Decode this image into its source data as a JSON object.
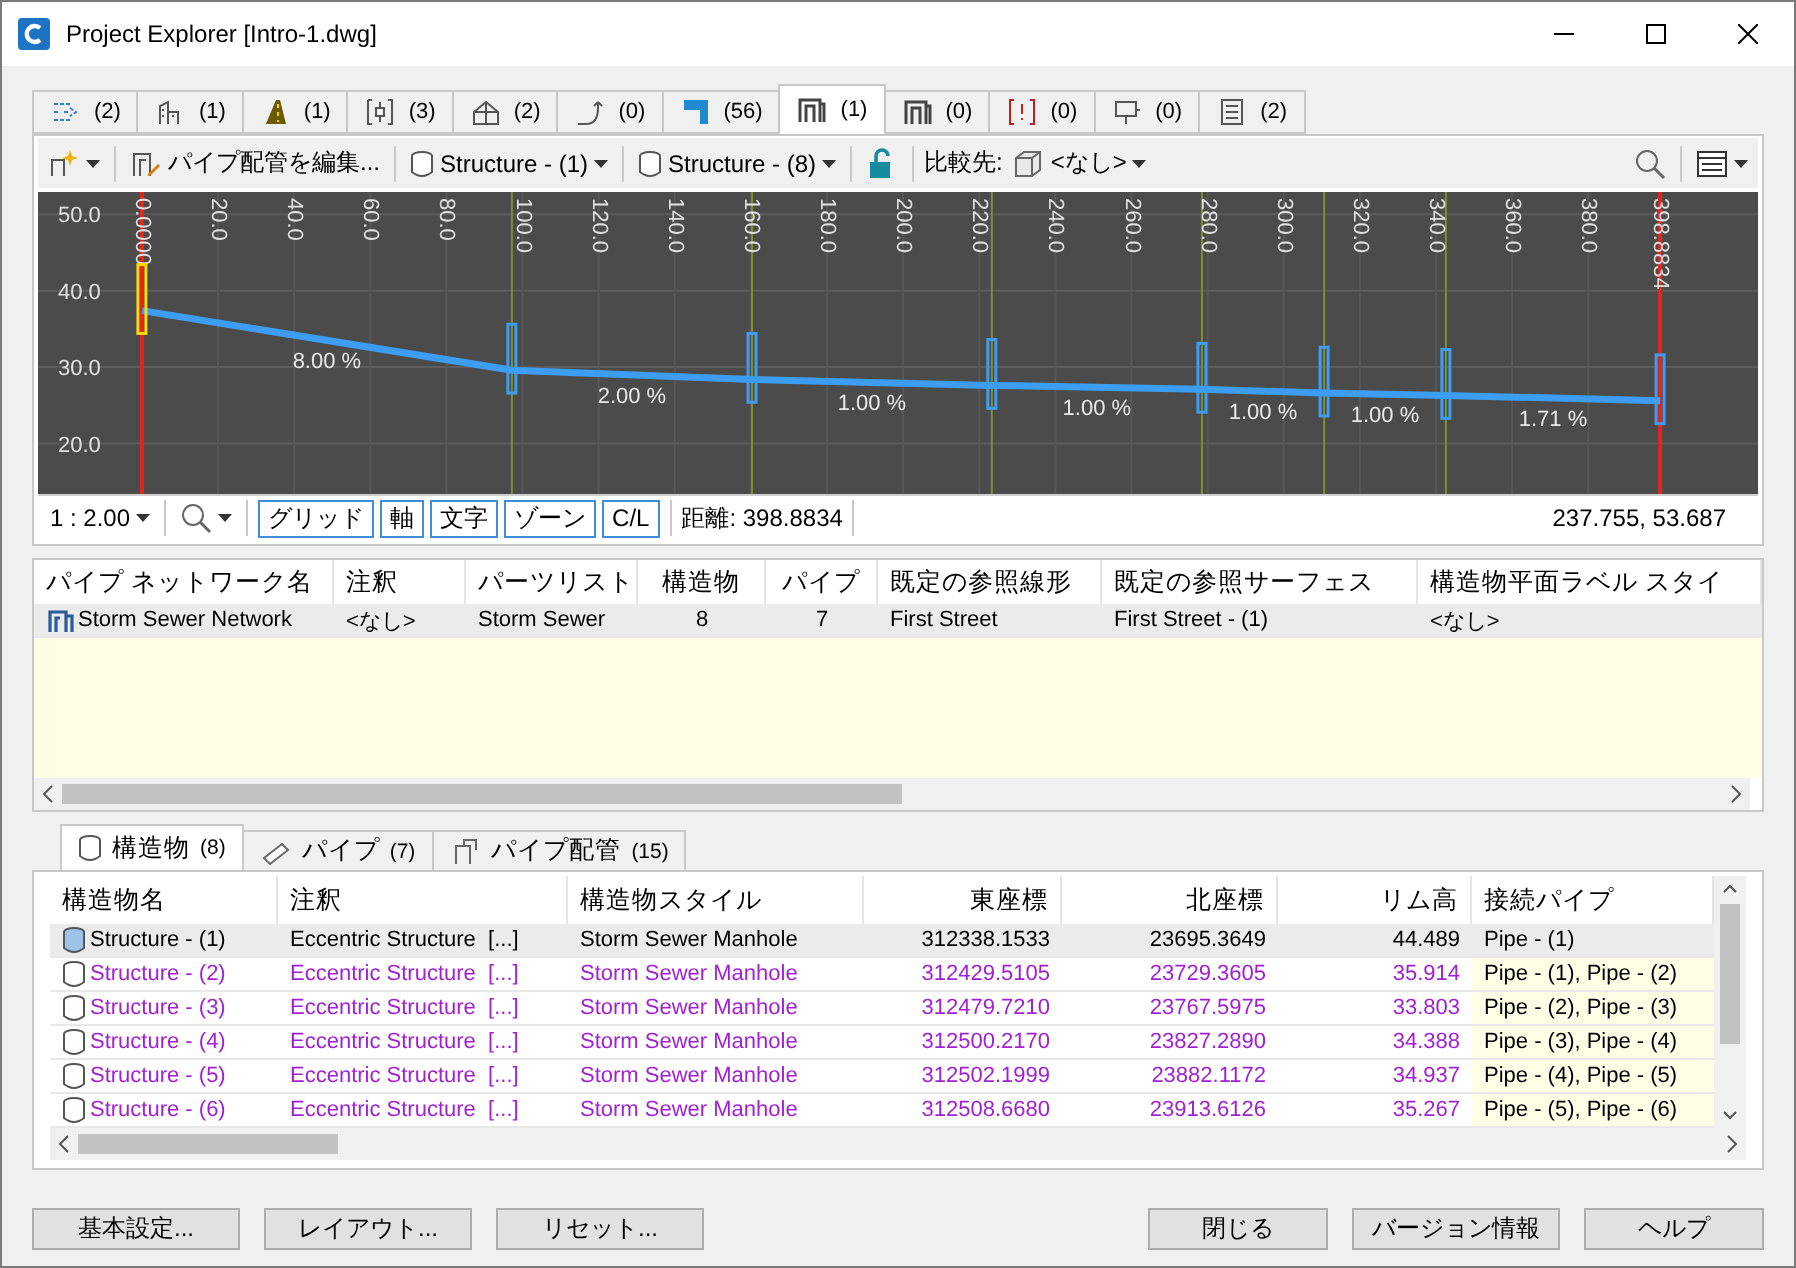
{
  "window": {
    "title": "Project Explorer [Intro-1.dwg]"
  },
  "category_tabs": [
    {
      "count": "(2)",
      "selected": false
    },
    {
      "count": "(1)",
      "selected": false
    },
    {
      "count": "(1)",
      "selected": false
    },
    {
      "count": "(3)",
      "selected": false
    },
    {
      "count": "(2)",
      "selected": false
    },
    {
      "count": "(0)",
      "selected": false
    },
    {
      "count": "(56)",
      "selected": false
    },
    {
      "count": "(1)",
      "selected": true
    },
    {
      "count": "(0)",
      "selected": false
    },
    {
      "count": "(0)",
      "selected": false
    },
    {
      "count": "(0)",
      "selected": false
    },
    {
      "count": "(2)",
      "selected": false
    }
  ],
  "toolbar": {
    "edit_button": "パイプ配管を編集...",
    "structure_from": "Structure - (1)",
    "structure_to": "Structure - (8)",
    "compare_label": "比較先:",
    "compare_value": "<なし>"
  },
  "profile": {
    "chart_data": {
      "type": "line",
      "grid": true,
      "x": [
        0,
        97.2,
        160.3,
        223.3,
        278.5,
        310.6,
        342.6,
        398.8834
      ],
      "series": [
        {
          "color": "#3d9df2",
          "values": [
            37.4,
            29.6,
            28.4,
            27.6,
            27.1,
            26.6,
            26.3,
            25.6
          ]
        }
      ],
      "xlim": [
        -27.3,
        424.6
      ],
      "ylim": [
        13.4,
        52.9
      ],
      "xticks": [
        {
          "value": 0,
          "label": "0.0000"
        },
        {
          "value": 20,
          "label": "20.0"
        },
        {
          "value": 40,
          "label": "40.0"
        },
        {
          "value": 60,
          "label": "60.0"
        },
        {
          "value": 80,
          "label": "80.0"
        },
        {
          "value": 100,
          "label": "100.0"
        },
        {
          "value": 120,
          "label": "120.0"
        },
        {
          "value": 140,
          "label": "140.0"
        },
        {
          "value": 160,
          "label": "160.0"
        },
        {
          "value": 180,
          "label": "180.0"
        },
        {
          "value": 200,
          "label": "200.0"
        },
        {
          "value": 220,
          "label": "220.0"
        },
        {
          "value": 240,
          "label": "240.0"
        },
        {
          "value": 260,
          "label": "260.0"
        },
        {
          "value": 280,
          "label": "280.0"
        },
        {
          "value": 300,
          "label": "300.0"
        },
        {
          "value": 320,
          "label": "320.0"
        },
        {
          "value": 340,
          "label": "340.0"
        },
        {
          "value": 360,
          "label": "360.0"
        },
        {
          "value": 380,
          "label": "380.0"
        },
        {
          "value": 398.8834,
          "label": "398.8834"
        }
      ],
      "yticks": [
        {
          "value": 20,
          "label": "20.0"
        },
        {
          "value": 30,
          "label": "30.0"
        },
        {
          "value": 40,
          "label": "40.0"
        },
        {
          "value": 50,
          "label": "50.0"
        }
      ],
      "annotations": [
        "8.00 %",
        "2.00 %",
        "1.00 %",
        "1.00 %",
        "1.00 %",
        "1.00 %",
        "1.71 %"
      ]
    }
  },
  "profile_bar": {
    "scale": "1 : 2.00",
    "toggles": [
      {
        "label": "グリッド",
        "selected": true
      },
      {
        "label": "軸",
        "selected": true
      },
      {
        "label": "文字",
        "selected": true
      },
      {
        "label": "ゾーン",
        "selected": true
      },
      {
        "label": "C/L",
        "selected": true
      }
    ],
    "distance": "距離: 398.8834",
    "coordinates": "237.755, 53.687"
  },
  "network_table": {
    "columns": [
      "パイプ ネットワーク名",
      "注釈",
      "パーツリスト",
      "構造物",
      "パイプ",
      "既定の参照線形",
      "既定の参照サーフェス",
      "構造物平面ラベル スタイ"
    ],
    "rows": [
      {
        "cells": [
          "Storm Sewer Network",
          "<なし>",
          "Storm Sewer",
          "8",
          "7",
          "First Street",
          "First Street - (1)",
          "<なし>"
        ],
        "selected": true
      }
    ]
  },
  "detail_tabs": [
    {
      "label": "構造物",
      "count": "(8)",
      "selected": true
    },
    {
      "label": "パイプ",
      "count": "(7)",
      "selected": false
    },
    {
      "label": "パイプ配管",
      "count": "(15)",
      "selected": false
    }
  ],
  "structure_table": {
    "columns": [
      "構造物名",
      "注釈",
      "構造物スタイル",
      "東座標",
      "北座標",
      "リム高",
      "接続パイプ"
    ],
    "rows": [
      {
        "cells": [
          "Structure - (1)",
          "Eccentric Structure  [...]",
          "Storm Sewer Manhole",
          "312338.1533",
          "23695.3649",
          "44.489",
          "Pipe - (1)"
        ],
        "selected": true,
        "color": "#000000"
      },
      {
        "cells": [
          "Structure - (2)",
          "Eccentric Structure  [...]",
          "Storm Sewer Manhole",
          "312429.5105",
          "23729.3605",
          "35.914",
          "Pipe - (1), Pipe - (2)"
        ],
        "selected": false,
        "color": "#a21fd4"
      },
      {
        "cells": [
          "Structure - (3)",
          "Eccentric Structure  [...]",
          "Storm Sewer Manhole",
          "312479.7210",
          "23767.5975",
          "33.803",
          "Pipe - (2), Pipe - (3)"
        ],
        "selected": false,
        "color": "#a21fd4"
      },
      {
        "cells": [
          "Structure - (4)",
          "Eccentric Structure  [...]",
          "Storm Sewer Manhole",
          "312500.2170",
          "23827.2890",
          "34.388",
          "Pipe - (3), Pipe - (4)"
        ],
        "selected": false,
        "color": "#a21fd4"
      },
      {
        "cells": [
          "Structure - (5)",
          "Eccentric Structure  [...]",
          "Storm Sewer Manhole",
          "312502.1999",
          "23882.1172",
          "34.937",
          "Pipe - (4), Pipe - (5)"
        ],
        "selected": false,
        "color": "#a21fd4"
      },
      {
        "cells": [
          "Structure - (6)",
          "Eccentric Structure  [...]",
          "Storm Sewer Manhole",
          "312508.6680",
          "23913.6126",
          "35.267",
          "Pipe - (5), Pipe - (6)"
        ],
        "selected": false,
        "color": "#a21fd4"
      }
    ]
  },
  "buttons_left": [
    "基本設定...",
    "レイアウト...",
    "リセット..."
  ],
  "buttons_right": [
    "閉じる",
    "バージョン情報",
    "ヘルプ"
  ]
}
